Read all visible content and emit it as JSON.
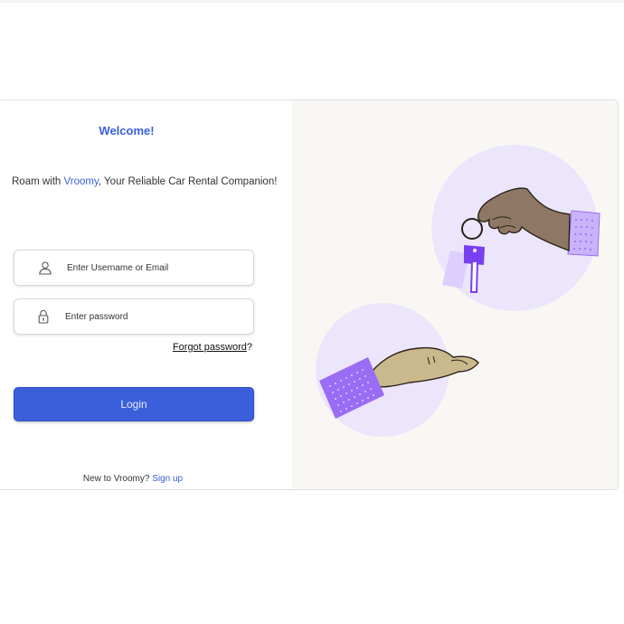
{
  "login": {
    "welcome": "Welcome!",
    "tagline_prefix": "Roam with ",
    "brand": "Vroomy",
    "tagline_suffix": ",  Your Reliable Car Rental Companion!",
    "username_placeholder": "Enter Username or Email",
    "password_placeholder": "Enter password",
    "forgot_label": "Forgot password",
    "forgot_suffix": "?",
    "login_button": "Login",
    "signup_prompt": "New to Vroomy? ",
    "signup_link": "Sign up"
  },
  "icons": {
    "username": "user-icon",
    "password": "lock-icon"
  },
  "colors": {
    "accent": "#3b5fdb",
    "illustration_circle": "#ebe6fc",
    "illustration_bg": "#f8f7f4",
    "key": "#7b3ff2",
    "sleeve": "#9b6cf5"
  }
}
